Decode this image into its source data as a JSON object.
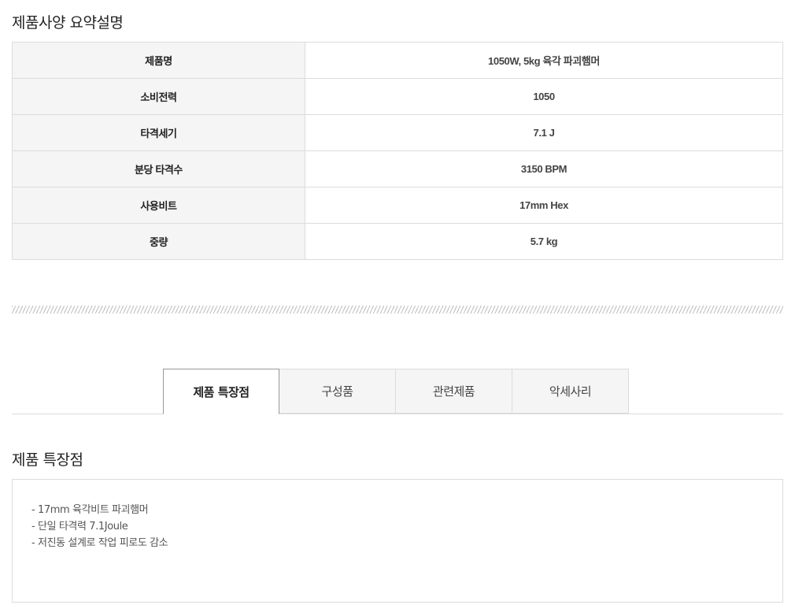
{
  "spec_section": {
    "title": "제품사양 요약설명",
    "rows": [
      {
        "label": "제품명",
        "value": "1050W, 5kg 육각 파괴햄머"
      },
      {
        "label": "소비전력",
        "value": "1050"
      },
      {
        "label": "타격세기",
        "value": "7.1 J"
      },
      {
        "label": "분당 타격수",
        "value": "3150 BPM"
      },
      {
        "label": "사용비트",
        "value": "17mm Hex"
      },
      {
        "label": "중량",
        "value": "5.7 kg"
      }
    ]
  },
  "tabs": [
    {
      "label": "제품 특장점",
      "active": true
    },
    {
      "label": "구성품",
      "active": false
    },
    {
      "label": "관련제품",
      "active": false
    },
    {
      "label": "악세사리",
      "active": false
    }
  ],
  "features_section": {
    "title": "제품 특장점",
    "items": [
      "- 17mm 육각비트 파괴햄머",
      "- 단일 타격력 7.1Joule",
      "- 저진동 설계로 작업 피로도 감소"
    ]
  }
}
